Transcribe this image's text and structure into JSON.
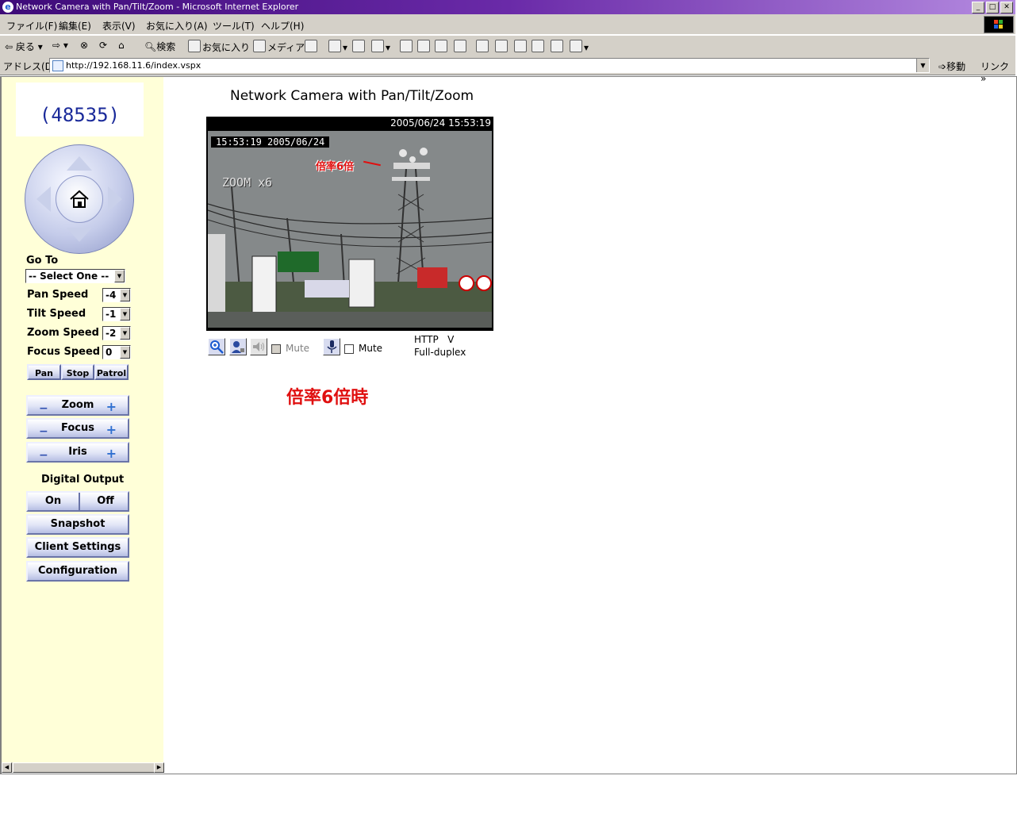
{
  "window": {
    "title": "Network Camera with Pan/Tilt/Zoom - Microsoft Internet Explorer",
    "min": "_",
    "max": "□",
    "close": "✕"
  },
  "menu": [
    "ファイル(F)",
    "編集(E)",
    "表示(V)",
    "お気に入り(A)",
    "ツール(T)",
    "ヘルプ(H)"
  ],
  "toolbar": {
    "back": "戻る",
    "search": "検索",
    "favorites": "お気に入り",
    "media": "メディア"
  },
  "address": {
    "label": "アドレス(D)",
    "url": "http://192.168.11.6/index.vspx",
    "go": "移動",
    "links": "リンク"
  },
  "sidebar": {
    "camera_id": "(48535)",
    "goto_label": "Go To",
    "goto_value": "-- Select One --",
    "pan_speed_label": "Pan Speed",
    "pan_speed": "-4",
    "tilt_speed_label": "Tilt Speed",
    "tilt_speed": "-1",
    "zoom_speed_label": "Zoom Speed",
    "zoom_speed": "-2",
    "focus_speed_label": "Focus Speed",
    "focus_speed": "0",
    "pan_btn": "Pan",
    "stop_btn": "Stop",
    "patrol_btn": "Patrol",
    "zoom_btn": "Zoom",
    "focus_btn": "Focus",
    "iris_btn": "Iris",
    "minus": "−",
    "plus": "+",
    "digital_output": "Digital Output",
    "on_btn": "On",
    "off_btn": "Off",
    "snapshot_btn": "Snapshot",
    "client_settings_btn": "Client Settings",
    "configuration_btn": "Configuration"
  },
  "main": {
    "title": "Network Camera with Pan/Tilt/Zoom",
    "header_timestamp": "2005/06/24 15:53:19",
    "osd_timestamp": "15:53:19 2005/06/24",
    "osd_zoom": "ZOOM x6",
    "annotation": "倍率6倍",
    "mute1": "Mute",
    "mute2": "Mute",
    "protocol_line1": "HTTP   V",
    "protocol_line2": "Full-duplex",
    "caption": "倍率6倍時"
  },
  "colors": {
    "sidebar_bg": "#ffffd8",
    "caption_red": "#e01010",
    "camera_id_blue": "#1a2a9a"
  }
}
